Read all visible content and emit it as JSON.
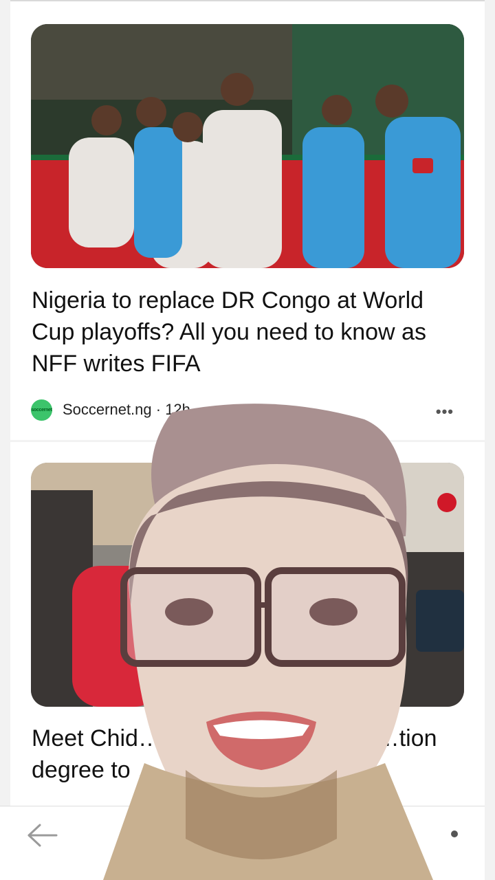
{
  "articles": [
    {
      "headline": "Nigeria to replace DR Congo at World Cup playoffs? All you need to know as NFF writes FIFA",
      "source": {
        "logo_text": "soccernet",
        "meta": "Soccernet.ng · 12h"
      },
      "image_icon": "football-match-photo",
      "more_icon": "more-dots-icon",
      "more_label": "•••"
    },
    {
      "headline": "Meet Chid… …ber driver who … …tion degree to …",
      "image_icon": "car-interior-photo"
    }
  ],
  "bottom_bar": {
    "back_icon": "back-arrow-icon",
    "menu_icon": "more-dot-icon"
  },
  "overlay": {
    "icon": "selfie-video-overlay"
  },
  "colors": {
    "background": "#f2f2f2",
    "card": "#ffffff",
    "text": "#111111",
    "source_logo": "#3cc46b"
  }
}
